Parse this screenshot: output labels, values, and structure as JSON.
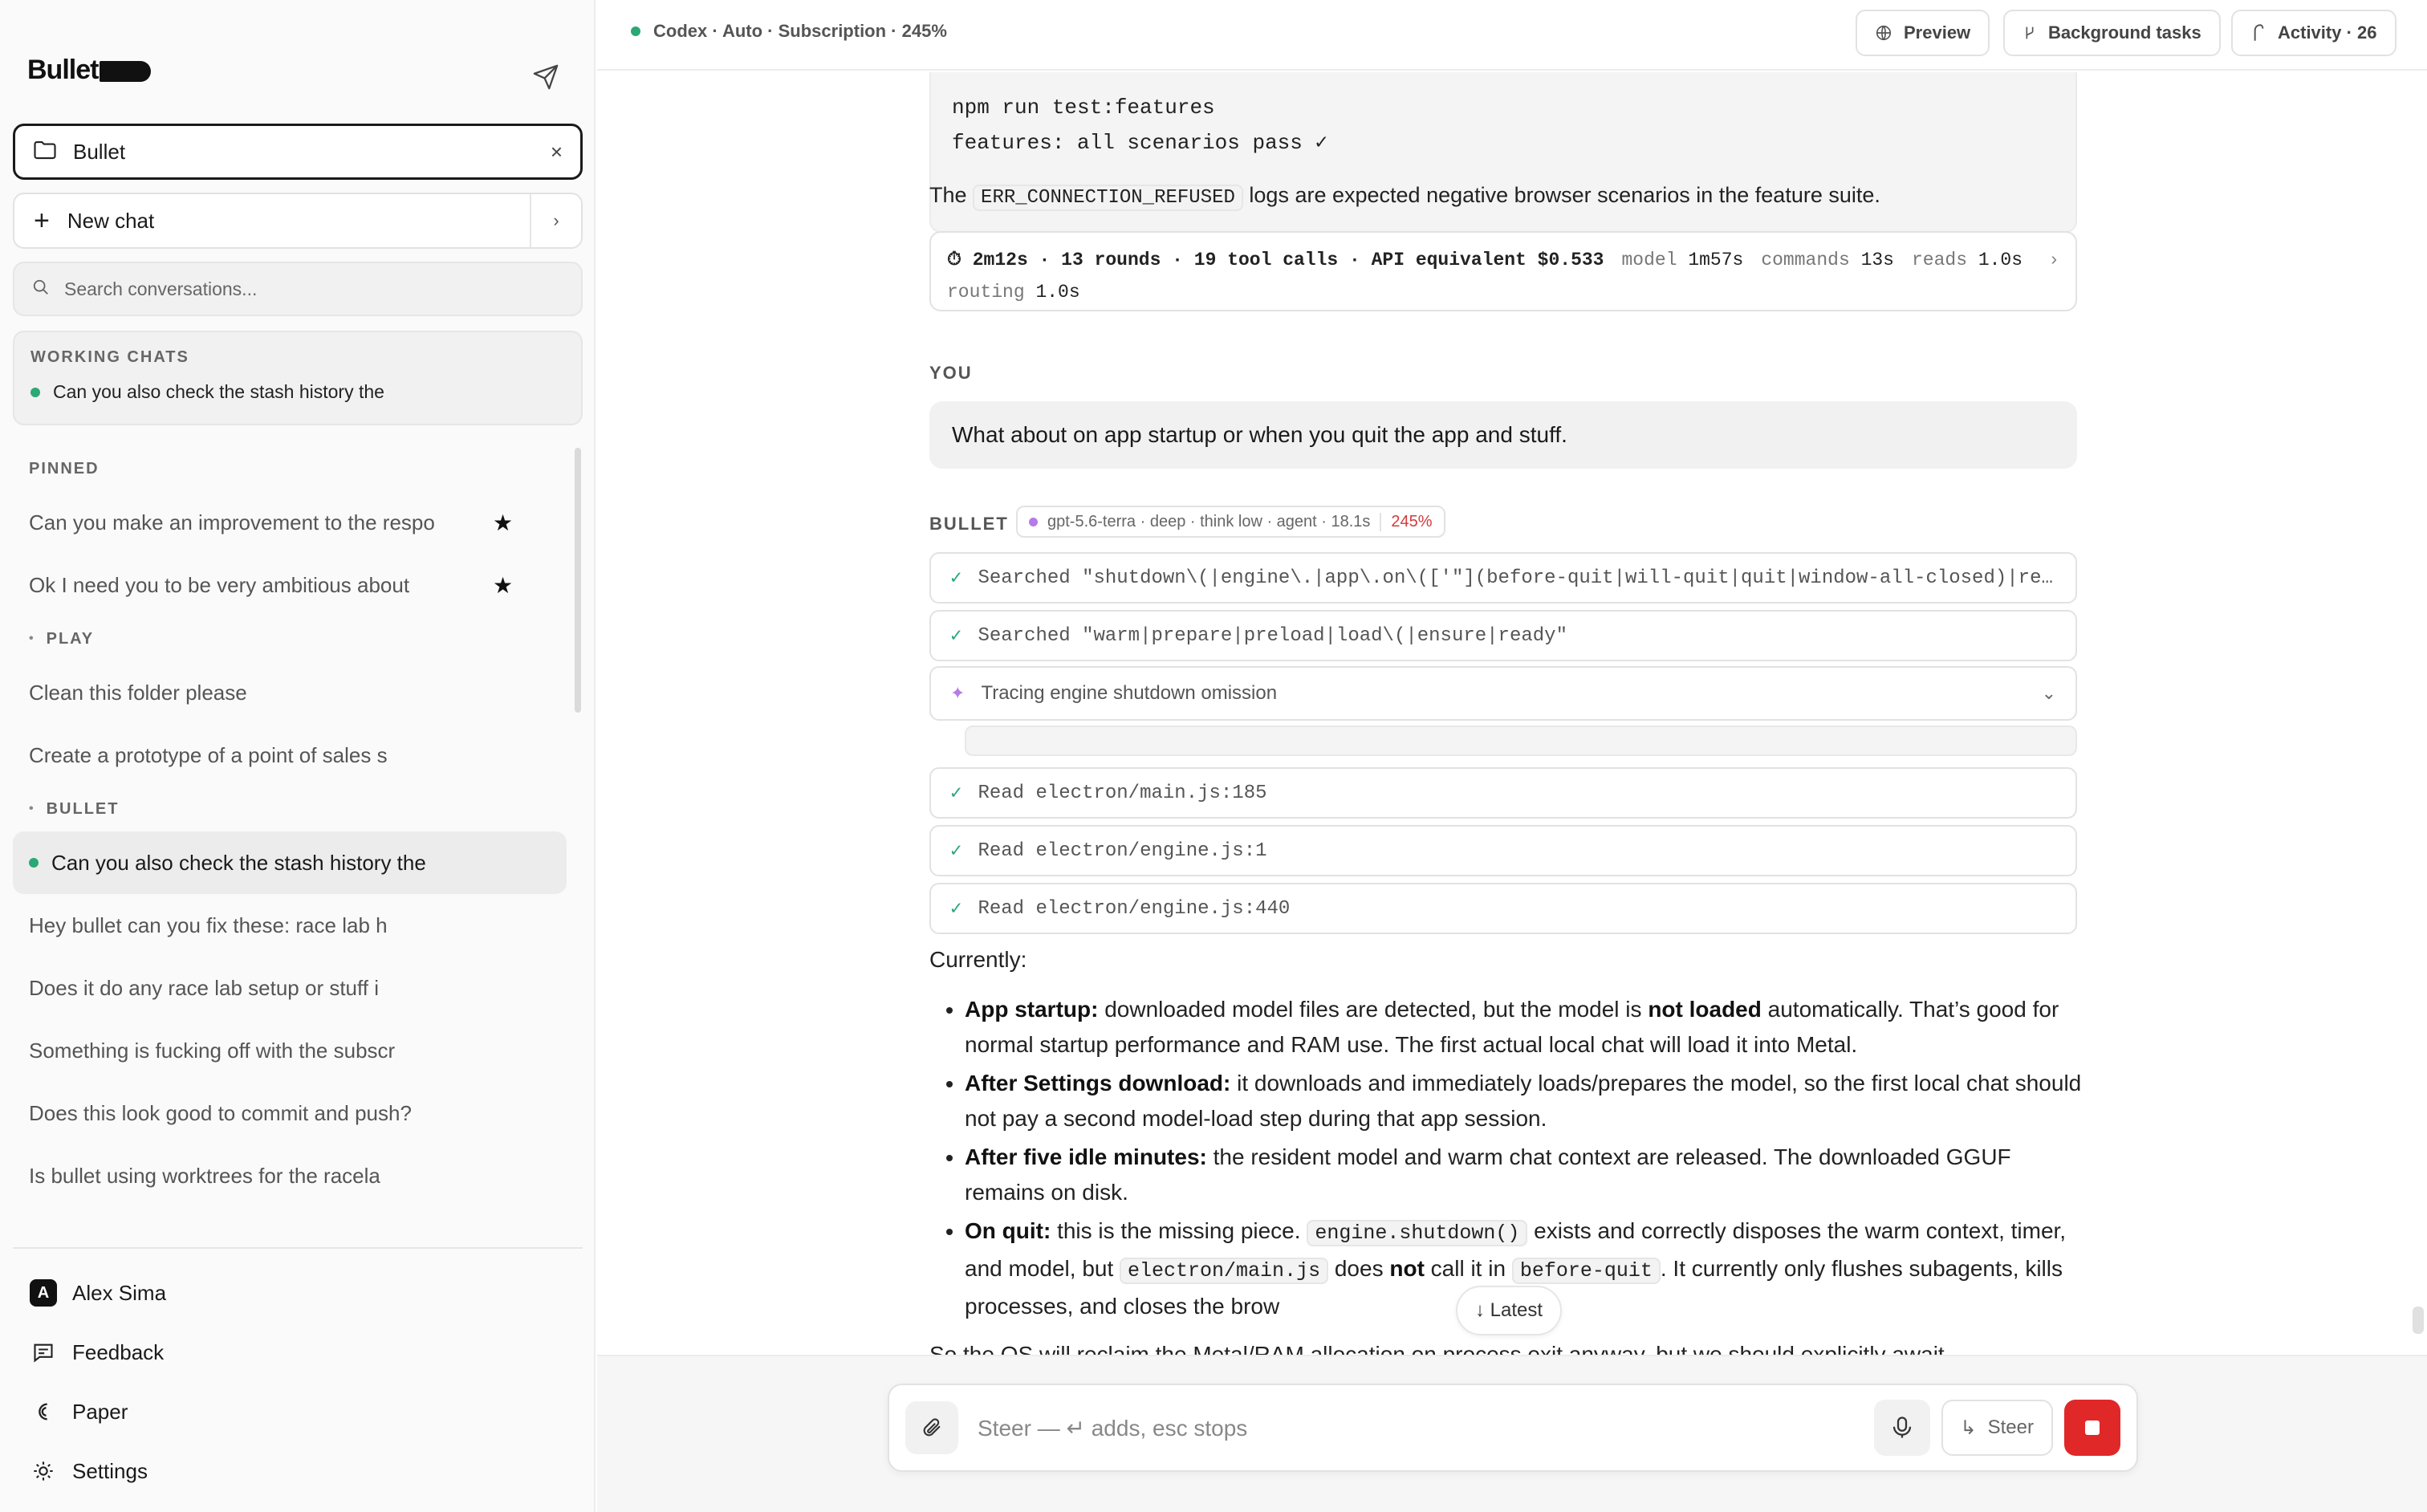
{
  "sidebar": {
    "brand": "Bullet",
    "project": {
      "label": "Bullet",
      "close": "×"
    },
    "new_chat": {
      "label": "New chat",
      "chevron": "›"
    },
    "search": {
      "placeholder": "Search conversations..."
    },
    "working": {
      "title": "WORKING CHATS",
      "item": "Can you also check the stash history the"
    },
    "sections": {
      "pinned": "PINNED",
      "play": "PLAY",
      "bullet": "BULLET"
    },
    "pinned_items": [
      {
        "label": "Can you make an improvement to the respo",
        "star": "★"
      },
      {
        "label": "Ok I need you to be very ambitious about",
        "star": "★"
      }
    ],
    "play_items": [
      "Clean this folder please",
      "Create a prototype of a point of sales s"
    ],
    "bullet_items": [
      "Can you also check the stash history the",
      "Hey bullet can you fix these: race lab h",
      "Does it do any race lab setup or stuff i",
      "Something is fucking off with the subscr",
      "Does this look good to commit and push?",
      "Is bullet using worktrees for the racela"
    ],
    "footer": {
      "user": "Alex Sima",
      "user_initial": "A",
      "feedback": "Feedback",
      "paper": "Paper",
      "settings": "Settings"
    }
  },
  "topbar": {
    "status": "Codex · Auto · Subscription · 245%",
    "preview": "Preview",
    "background_tasks": "Background tasks",
    "activity": "Activity · 26"
  },
  "chat": {
    "code_lines": [
      "npm run test:features",
      "features: all scenarios pass ✓"
    ],
    "note": {
      "before": "The",
      "code": "ERR_CONNECTION_REFUSED",
      "after": "logs are expected negative browser scenarios in the feature suite."
    },
    "stats": {
      "summary": "⏱ 2m12s · 13 rounds · 19 tool calls · API equivalent $0.533",
      "model_k": "model",
      "model_v": "1m57s",
      "commands_k": "commands",
      "commands_v": "13s",
      "reads_k": "reads",
      "reads_v": "1.0s",
      "routing_k": "routing",
      "routing_v": "1.0s",
      "arrow": "›"
    },
    "you_label": "YOU",
    "user_message": "What about on app startup or when you quit the app and stuff.",
    "bullet_label": "BULLET",
    "meta": {
      "text": "gpt-5.6-terra · deep · think low · agent · 18.1s",
      "pct": "245%"
    },
    "tools": [
      {
        "icon": "✓",
        "text": "Searched \"shutdown\\(|engine\\.|app\\.on\\(['\"](before-quit|will-quit|quit|window-all-closed)|re..."
      },
      {
        "icon": "✓",
        "text": "Searched \"warm|prepare|preload|load\\(|ensure|ready\""
      },
      {
        "icon": "✦",
        "text": "Tracing engine shutdown omission",
        "caret": "⌄"
      },
      {
        "icon": "✓",
        "text": "Read electron/main.js:185"
      },
      {
        "icon": "✓",
        "text": "Read electron/engine.js:1"
      },
      {
        "icon": "✓",
        "text": "Read electron/engine.js:440"
      }
    ],
    "answer": {
      "intro": "Currently:",
      "b1_label": "App startup:",
      "b1_a": " downloaded model files are detected, but the model is ",
      "b1_bold": "not loaded",
      "b1_b": " automatically. That’s good for normal startup performance and RAM use. The first actual local chat will load it into Metal.",
      "b2_label": "After Settings download:",
      "b2_text": " it downloads and immediately loads/prepares the model, so the first local chat should not pay a second model-load step during that app session.",
      "b3_label": "After five idle minutes:",
      "b3_text": " the resident model and warm chat context are released. The downloaded GGUF remains on disk.",
      "b4_label": "On quit:",
      "b4_a": " this is the missing piece. ",
      "b4_code1": "engine.shutdown()",
      "b4_b": " exists and correctly disposes the warm context, timer, and model, but ",
      "b4_code2": "electron/main.js",
      "b4_c": " does ",
      "b4_bold": "not",
      "b4_d": " call it in ",
      "b4_code3": "before-quit",
      "b4_e": ". It currently only flushes subagents, kills processes, and closes the brow",
      "tail": "So the OS will reclaim the Metal/RAM allocation on process exit anyway, but we should explicitly await"
    },
    "latest": "↓ Latest"
  },
  "composer": {
    "placeholder": "Steer — ↵ adds, esc stops",
    "steer_label": "Steer",
    "stop_color": "#e02828"
  }
}
